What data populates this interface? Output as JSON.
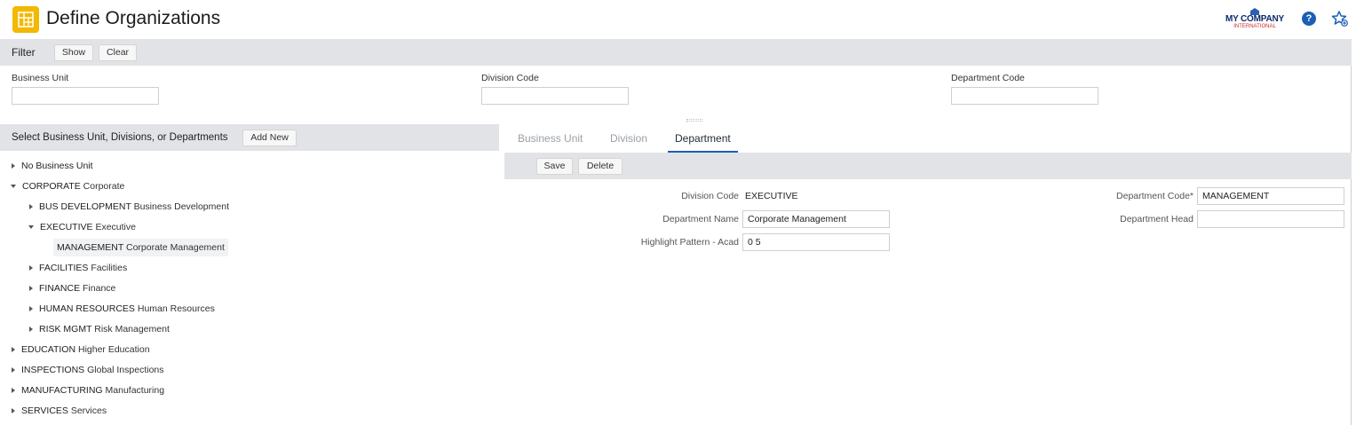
{
  "header": {
    "title": "Define Organizations",
    "app_icon": "grid-icon",
    "logo": {
      "main": "MY COMPANY",
      "sub": "INTERNATIONAL"
    },
    "help_icon": "?",
    "favorite_icon": "star-add-icon"
  },
  "filter": {
    "label": "Filter",
    "show_label": "Show",
    "clear_label": "Clear",
    "fields": [
      {
        "label": "Business Unit",
        "value": ""
      },
      {
        "label": "Division Code",
        "value": ""
      },
      {
        "label": "Department Code",
        "value": ""
      }
    ]
  },
  "left_panel": {
    "title": "Select Business Unit, Divisions, or Departments",
    "add_new_label": "Add New",
    "tree": [
      {
        "code": "No Business Unit",
        "name": "",
        "expanded": false
      },
      {
        "code": "CORPORATE",
        "name": "Corporate",
        "expanded": true
      },
      {
        "code": "BUS DEVELOPMENT",
        "name": "Business Development",
        "expanded": false
      },
      {
        "code": "EXECUTIVE",
        "name": "Executive",
        "expanded": true
      },
      {
        "code": "MANAGEMENT",
        "name": "Corporate Management",
        "selected": true
      },
      {
        "code": "FACILITIES",
        "name": "Facilities",
        "expanded": false
      },
      {
        "code": "FINANCE",
        "name": "Finance",
        "expanded": false
      },
      {
        "code": "HUMAN RESOURCES",
        "name": "Human Resources",
        "expanded": false
      },
      {
        "code": "RISK MGMT",
        "name": "Risk Management",
        "expanded": false
      },
      {
        "code": "EDUCATION",
        "name": "Higher Education",
        "expanded": false
      },
      {
        "code": "INSPECTIONS",
        "name": "Global Inspections",
        "expanded": false
      },
      {
        "code": "MANUFACTURING",
        "name": "Manufacturing",
        "expanded": false
      },
      {
        "code": "SERVICES",
        "name": "Services",
        "expanded": false
      }
    ]
  },
  "right_panel": {
    "tabs": [
      "Business Unit",
      "Division",
      "Department"
    ],
    "active_tab": "Department",
    "save_label": "Save",
    "delete_label": "Delete",
    "form": {
      "division_code_label": "Division Code",
      "division_code_value": "EXECUTIVE",
      "department_name_label": "Department Name",
      "department_name_value": "Corporate Management",
      "highlight_pattern_label": "Highlight Pattern - Acad",
      "highlight_pattern_value": "0 5",
      "department_code_label": "Department Code*",
      "department_code_value": "MANAGEMENT",
      "department_head_label": "Department Head",
      "department_head_value": ""
    }
  },
  "colors": {
    "accent": "#1b5fb5",
    "app_icon": "#f3b800",
    "bar_bg": "#e1e3e6"
  }
}
